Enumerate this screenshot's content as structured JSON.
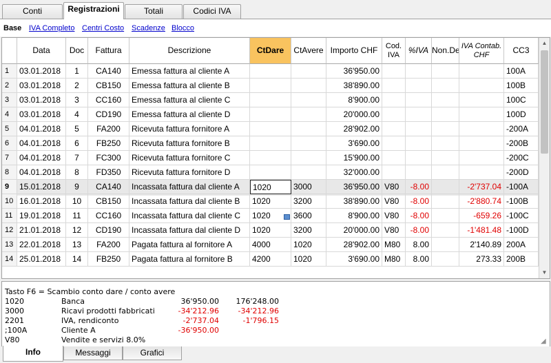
{
  "top_tabs": [
    "Conti",
    "Registrazioni",
    "Totali",
    "Codici IVA"
  ],
  "view_links": [
    "Base",
    "IVA Completo",
    "Centri Costo",
    "Scadenze",
    "Blocco"
  ],
  "columns": [
    "Data",
    "Doc",
    "Fattura",
    "Descrizione",
    "CtDare",
    "CtAvere",
    "Importo CHF",
    "Cod. IVA",
    "%IVA",
    "Non.Ded",
    "IVA Contab. CHF",
    "CC3"
  ],
  "rows": [
    {
      "n": "1",
      "data": "03.01.2018",
      "doc": "1",
      "fattura": "CA140",
      "desc": "Emessa fattura al cliente A",
      "ctdare": "",
      "ctavere": "",
      "importo": "36'950.00",
      "codiva": "",
      "piva": "",
      "nonded": "",
      "ivacontab": "",
      "cc3": "100A"
    },
    {
      "n": "2",
      "data": "03.01.2018",
      "doc": "2",
      "fattura": "CB150",
      "desc": "Emessa fattura al cliente B",
      "ctdare": "",
      "ctavere": "",
      "importo": "38'890.00",
      "codiva": "",
      "piva": "",
      "nonded": "",
      "ivacontab": "",
      "cc3": "100B"
    },
    {
      "n": "3",
      "data": "03.01.2018",
      "doc": "3",
      "fattura": "CC160",
      "desc": "Emessa fattura al cliente C",
      "ctdare": "",
      "ctavere": "",
      "importo": "8'900.00",
      "codiva": "",
      "piva": "",
      "nonded": "",
      "ivacontab": "",
      "cc3": "100C"
    },
    {
      "n": "4",
      "data": "03.01.2018",
      "doc": "4",
      "fattura": "CD190",
      "desc": "Emessa fattura al cliente D",
      "ctdare": "",
      "ctavere": "",
      "importo": "20'000.00",
      "codiva": "",
      "piva": "",
      "nonded": "",
      "ivacontab": "",
      "cc3": "100D"
    },
    {
      "n": "5",
      "data": "04.01.2018",
      "doc": "5",
      "fattura": "FA200",
      "desc": "Ricevuta fattura fornitore A",
      "ctdare": "",
      "ctavere": "",
      "importo": "28'902.00",
      "codiva": "",
      "piva": "",
      "nonded": "",
      "ivacontab": "",
      "cc3": "-200A"
    },
    {
      "n": "6",
      "data": "04.01.2018",
      "doc": "6",
      "fattura": "FB250",
      "desc": "Ricevuta fattura fornitore B",
      "ctdare": "",
      "ctavere": "",
      "importo": "3'690.00",
      "codiva": "",
      "piva": "",
      "nonded": "",
      "ivacontab": "",
      "cc3": "-200B"
    },
    {
      "n": "7",
      "data": "04.01.2018",
      "doc": "7",
      "fattura": "FC300",
      "desc": "Ricevuta fattura fornitore C",
      "ctdare": "",
      "ctavere": "",
      "importo": "15'900.00",
      "codiva": "",
      "piva": "",
      "nonded": "",
      "ivacontab": "",
      "cc3": "-200C"
    },
    {
      "n": "8",
      "data": "04.01.2018",
      "doc": "8",
      "fattura": "FD350",
      "desc": "Ricevuta fattura fornitore D",
      "ctdare": "",
      "ctavere": "",
      "importo": "32'000.00",
      "codiva": "",
      "piva": "",
      "nonded": "",
      "ivacontab": "",
      "cc3": "-200D"
    },
    {
      "n": "9",
      "data": "15.01.2018",
      "doc": "9",
      "fattura": "CA140",
      "desc": "Incassata fattura dal cliente A",
      "ctdare": "1020",
      "ctavere": "3000",
      "importo": "36'950.00",
      "codiva": "V80",
      "piva": "-8.00",
      "nonded": "",
      "ivacontab": "-2'737.04",
      "cc3": "-100A"
    },
    {
      "n": "10",
      "data": "16.01.2018",
      "doc": "10",
      "fattura": "CB150",
      "desc": "Incassata fattura dal cliente B",
      "ctdare": "1020",
      "ctavere": "3200",
      "importo": "38'890.00",
      "codiva": "V80",
      "piva": "-8.00",
      "nonded": "",
      "ivacontab": "-2'880.74",
      "cc3": "-100B"
    },
    {
      "n": "11",
      "data": "19.01.2018",
      "doc": "11",
      "fattura": "CC160",
      "desc": "Incassata fattura dal cliente C",
      "ctdare": "1020",
      "ctavere": "3600",
      "importo": "8'900.00",
      "codiva": "V80",
      "piva": "-8.00",
      "nonded": "",
      "ivacontab": "-659.26",
      "cc3": "-100C"
    },
    {
      "n": "12",
      "data": "21.01.2018",
      "doc": "12",
      "fattura": "CD190",
      "desc": "Incassata fattura dal cliente D",
      "ctdare": "1020",
      "ctavere": "3200",
      "importo": "20'000.00",
      "codiva": "V80",
      "piva": "-8.00",
      "nonded": "",
      "ivacontab": "-1'481.48",
      "cc3": "-100D"
    },
    {
      "n": "13",
      "data": "22.01.2018",
      "doc": "13",
      "fattura": "FA200",
      "desc": "Pagata fattura al fornitore A",
      "ctdare": "4000",
      "ctavere": "1020",
      "importo": "28'902.00",
      "codiva": "M80",
      "piva": "8.00",
      "nonded": "",
      "ivacontab": "2'140.89",
      "cc3": "200A"
    },
    {
      "n": "14",
      "data": "25.01.2018",
      "doc": "14",
      "fattura": "FB250",
      "desc": "Pagata fattura al fornitore B",
      "ctdare": "4200",
      "ctavere": "1020",
      "importo": "3'690.00",
      "codiva": "M80",
      "piva": "8.00",
      "nonded": "",
      "ivacontab": "273.33",
      "cc3": "200B"
    }
  ],
  "info": {
    "hint": "Tasto F6 = Scambio conto dare / conto avere",
    "lines": [
      {
        "code": "1020",
        "name": "Banca",
        "v1": "36'950.00",
        "v2": "176'248.00"
      },
      {
        "code": "3000",
        "name": "Ricavi prodotti fabbricati",
        "v1": "-34'212.96",
        "v2": "-34'212.96"
      },
      {
        "code": "2201",
        "name": "IVA, rendiconto",
        "v1": "-2'737.04",
        "v2": "-1'796.15"
      },
      {
        "code": ";100A",
        "name": "Cliente A",
        "v1": "-36'950.00",
        "v2": ""
      },
      {
        "code": "V80",
        "name": "Vendite e servizi 8.0%",
        "v1": "",
        "v2": ""
      }
    ]
  },
  "bottom_tabs": [
    "Info",
    "Messaggi",
    "Grafici"
  ],
  "colors": {
    "selected_header": "#f9c35f",
    "negative": "#e00000",
    "link": "#0000cc"
  }
}
